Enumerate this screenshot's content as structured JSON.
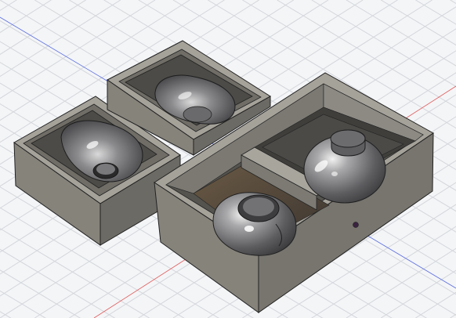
{
  "viewport": {
    "background": "#f4f5f7",
    "grid_color": "#d3d6db",
    "axis_x_color": "#e05a5a",
    "axis_y_color": "#5a6ee0",
    "body_color": "#8a877f",
    "body_top_color": "#a7a49c",
    "body_dark_color": "#5b5954",
    "inner_floor_color": "#4a4945",
    "brown_floor_color": "#6b5a45",
    "ball_color": "#6f6f72",
    "origin_point_color": "#3a2340"
  },
  "objects": [
    "mold-block-left",
    "mold-block-middle",
    "open-box-right",
    "sphere-front",
    "sphere-back"
  ]
}
